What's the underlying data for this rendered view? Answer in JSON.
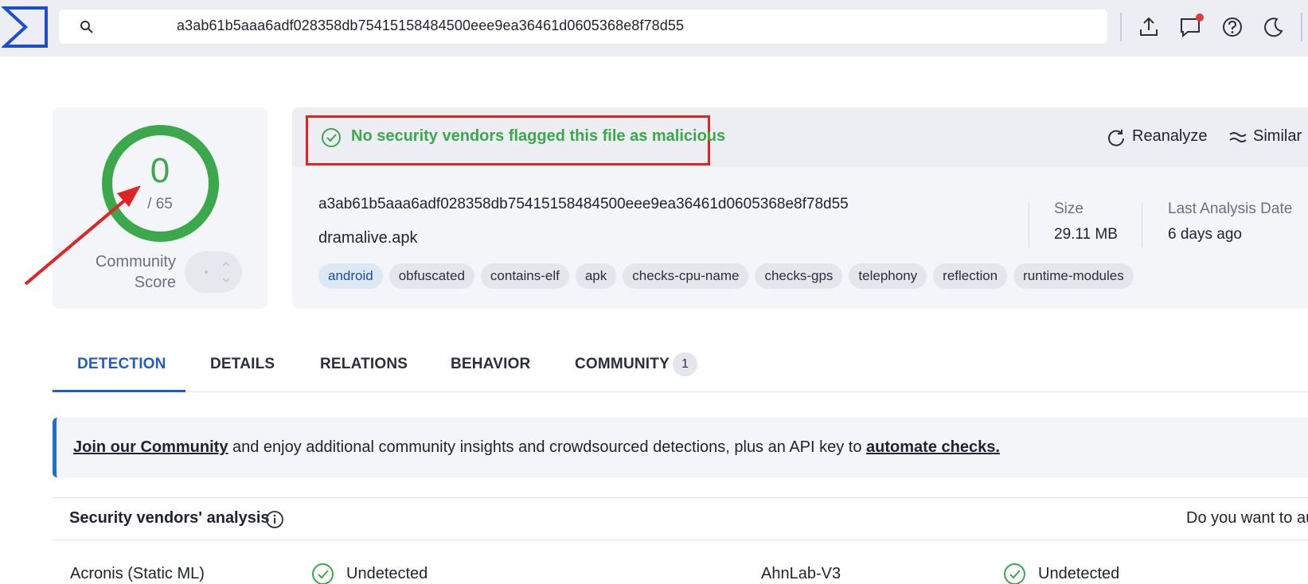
{
  "search": {
    "value": "a3ab61b5aaa6adf028358db75415158484500eee9ea36461d0605368e8f78d55"
  },
  "topbar_icons": [
    "upload-icon",
    "chat-icon",
    "help-icon",
    "dark-mode-icon"
  ],
  "score": {
    "value": "0",
    "total": "/ 65",
    "community_label_1": "Community",
    "community_label_2": "Score"
  },
  "verdict": {
    "text": "No security vendors flagged this file as malicious",
    "color": "#3ba84c"
  },
  "actions": {
    "reanalyze": "Reanalyze",
    "similar": "Similar"
  },
  "file": {
    "hash": "a3ab61b5aaa6adf028358db75415158484500eee9ea36461d0605368e8f78d55",
    "name": "dramalive.apk",
    "tags": [
      "android",
      "obfuscated",
      "contains-elf",
      "apk",
      "checks-cpu-name",
      "checks-gps",
      "telephony",
      "reflection",
      "runtime-modules"
    ],
    "size_label": "Size",
    "size_value": "29.11 MB",
    "date_label": "Last Analysis Date",
    "date_value": "6 days ago"
  },
  "tabs": [
    {
      "label": "DETECTION",
      "active": true
    },
    {
      "label": "DETAILS"
    },
    {
      "label": "RELATIONS"
    },
    {
      "label": "BEHAVIOR"
    },
    {
      "label": "COMMUNITY",
      "badge": "1"
    }
  ],
  "banner": {
    "link1": "Join our Community",
    "middle": " and enjoy additional community insights and crowdsourced detections, plus an API key to ",
    "link2": "automate checks."
  },
  "vendors": {
    "title": "Security vendors' analysis",
    "right_text": "Do you want to au",
    "rows": [
      {
        "name": "Acronis (Static ML)",
        "status": "Undetected",
        "name2": "AhnLab-V3",
        "status2": "Undetected"
      }
    ]
  },
  "colors": {
    "accent": "#1b5ec4",
    "clean": "#3ba84c",
    "highlight_box": "#e02323"
  }
}
